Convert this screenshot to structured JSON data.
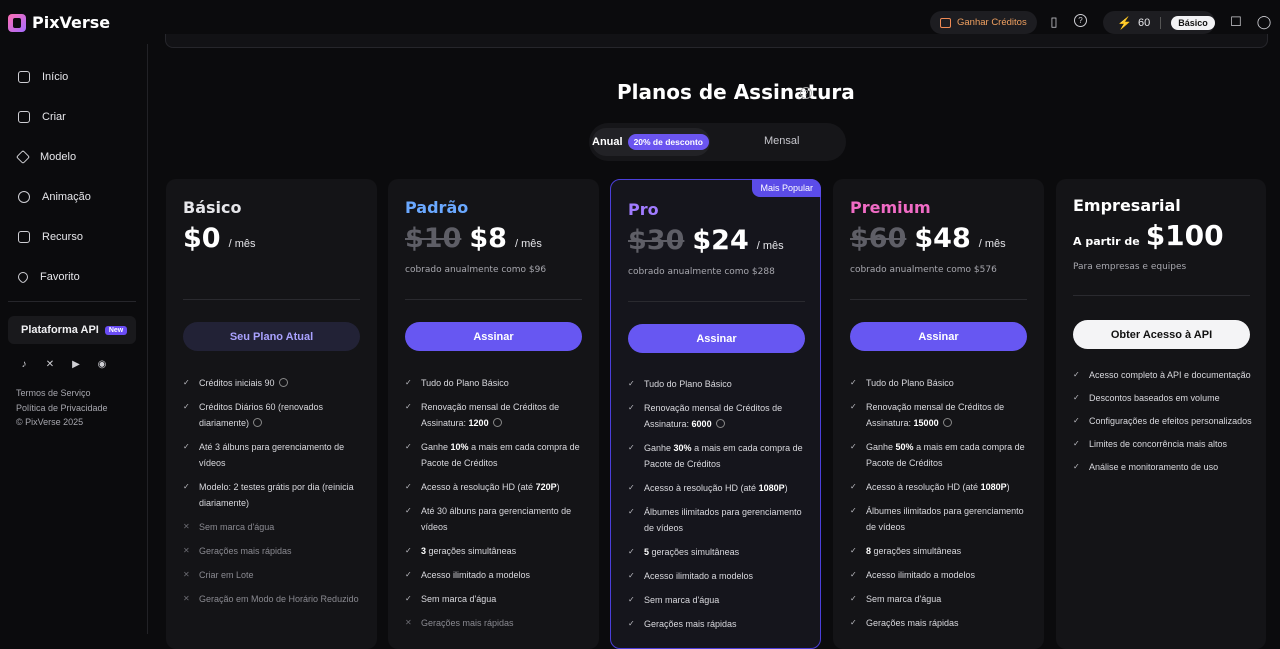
{
  "header": {
    "brand": "PixVerse",
    "earn_credits": "Ganhar Créditos",
    "credits": "60",
    "plan_badge": "Básico"
  },
  "sidebar": {
    "items": [
      {
        "label": "Início",
        "icon": "home-icon"
      },
      {
        "label": "Criar",
        "icon": "create-icon"
      },
      {
        "label": "Modelo",
        "icon": "model-icon"
      },
      {
        "label": "Animação",
        "icon": "animation-icon"
      },
      {
        "label": "Recurso",
        "icon": "folder-icon"
      },
      {
        "label": "Favorito",
        "icon": "heart-icon"
      }
    ],
    "api": {
      "label": "Plataforma API",
      "badge": "New"
    },
    "legal": [
      "Termos de Serviço",
      "Política de Privacidade",
      "© PixVerse 2025"
    ]
  },
  "page": {
    "title": "Planos de Assinatura",
    "toggle": {
      "annual": "Anual",
      "discount": "20% de desconto",
      "monthly": "Mensal"
    }
  },
  "plans": {
    "basic": {
      "name": "Básico",
      "price": "$0",
      "per": "/ mês",
      "cta": "Seu Plano Atual",
      "features": [
        "Créditos iniciais 90",
        "Créditos Diários 60 (renovados diariamente)",
        "Até 3 álbuns para gerenciamento de vídeos",
        "Modelo: 2 testes grátis por dia (reinicia diariamente)",
        "Sem marca d'água",
        "Gerações mais rápidas",
        "Criar em Lote",
        "Geração em Modo de Horário Reduzido"
      ]
    },
    "standard": {
      "name": "Padrão",
      "old_price": "$10",
      "price": "$8",
      "per": "/ mês",
      "billed": "cobrado anualmente como $96",
      "cta": "Assinar",
      "f1": "Tudo do Plano Básico",
      "f2a": "Renovação mensal de Créditos de Assinatura:",
      "f2b": "1200",
      "f3a": "Ganhe",
      "f3b": "10%",
      "f3c": "a mais em cada compra de Pacote de Créditos",
      "f4a": "Acesso à resolução HD (até",
      "f4b": "720P",
      "f4c": ")",
      "f5": "Até 30 álbuns para gerenciamento de vídeos",
      "f6a": "3",
      "f6b": "gerações simultâneas",
      "f7": "Acesso ilimitado a modelos",
      "f8": "Sem marca d'água",
      "f9": "Gerações mais rápidas"
    },
    "pro": {
      "name": "Pro",
      "badge": "Mais Popular",
      "old_price": "$30",
      "price": "$24",
      "per": "/ mês",
      "billed": "cobrado anualmente como $288",
      "cta": "Assinar",
      "f1": "Tudo do Plano Básico",
      "f2a": "Renovação mensal de Créditos de Assinatura:",
      "f2b": "6000",
      "f3a": "Ganhe",
      "f3b": "30%",
      "f3c": "a mais em cada compra de Pacote de Créditos",
      "f4a": "Acesso à resolução HD (até",
      "f4b": "1080P",
      "f4c": ")",
      "f5": "Álbumes ilimitados para gerenciamento de vídeos",
      "f6a": "5",
      "f6b": "gerações simultâneas",
      "f7": "Acesso ilimitado a modelos",
      "f8": "Sem marca d'água",
      "f9": "Gerações mais rápidas"
    },
    "premium": {
      "name": "Premium",
      "old_price": "$60",
      "price": "$48",
      "per": "/ mês",
      "billed": "cobrado anualmente como $576",
      "cta": "Assinar",
      "f1": "Tudo do Plano Básico",
      "f2a": "Renovação mensal de Créditos de Assinatura:",
      "f2b": "15000",
      "f3a": "Ganhe",
      "f3b": "50%",
      "f3c": "a mais em cada compra de Pacote de Créditos",
      "f4a": "Acesso à resolução HD (até",
      "f4b": "1080P",
      "f4c": ")",
      "f5": "Álbumes ilimitados para gerenciamento de vídeos",
      "f6a": "8",
      "f6b": "gerações simultâneas",
      "f7": "Acesso ilimitado a modelos",
      "f8": "Sem marca d'água",
      "f9": "Gerações mais rápidas"
    },
    "enterprise": {
      "name": "Empresarial",
      "from": "A partir de",
      "price": "$100",
      "subtitle": "Para empresas e equipes",
      "cta": "Obter Acesso à API",
      "features": [
        "Acesso completo à API e documentação",
        "Descontos baseados em volume",
        "Configurações de efeitos personalizados",
        "Limites de concorrência mais altos",
        "Análise e monitoramento de uso"
      ]
    }
  },
  "colors": {
    "accent": "#6757f2",
    "standard": "#6aa8ff",
    "pro": "#a07bff",
    "premium": "#f06bc5"
  }
}
